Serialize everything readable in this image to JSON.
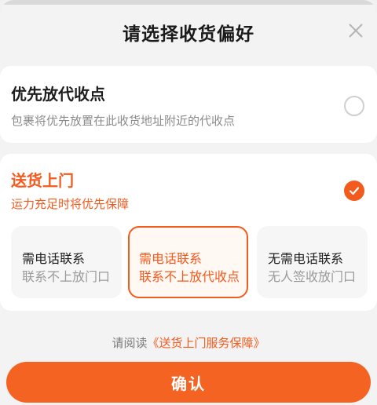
{
  "header": {
    "title": "请选择收货偏好"
  },
  "option_pickup": {
    "title": "优先放代收点",
    "subtitle": "包裹将优先放置在此收货地址附近的代收点",
    "selected": false
  },
  "option_door": {
    "title": "送货上门",
    "subtitle": "运力充足时将优先保障",
    "selected": true,
    "sub_options": [
      {
        "line1": "需电话联系",
        "line2": "联系不上放门口",
        "selected": false
      },
      {
        "line1": "需电话联系",
        "line2": "联系不上放代收点",
        "selected": true
      },
      {
        "line1": "无需电话联系",
        "line2": "无人签收放门口",
        "selected": false
      }
    ]
  },
  "footer": {
    "read_prefix": "请阅读",
    "read_link": "《送货上门服务保障》",
    "confirm_label": "确认"
  },
  "colors": {
    "accent": "#f25a1e",
    "button": "#f56322"
  },
  "icons": {
    "close": "close-icon",
    "check": "check-icon"
  }
}
